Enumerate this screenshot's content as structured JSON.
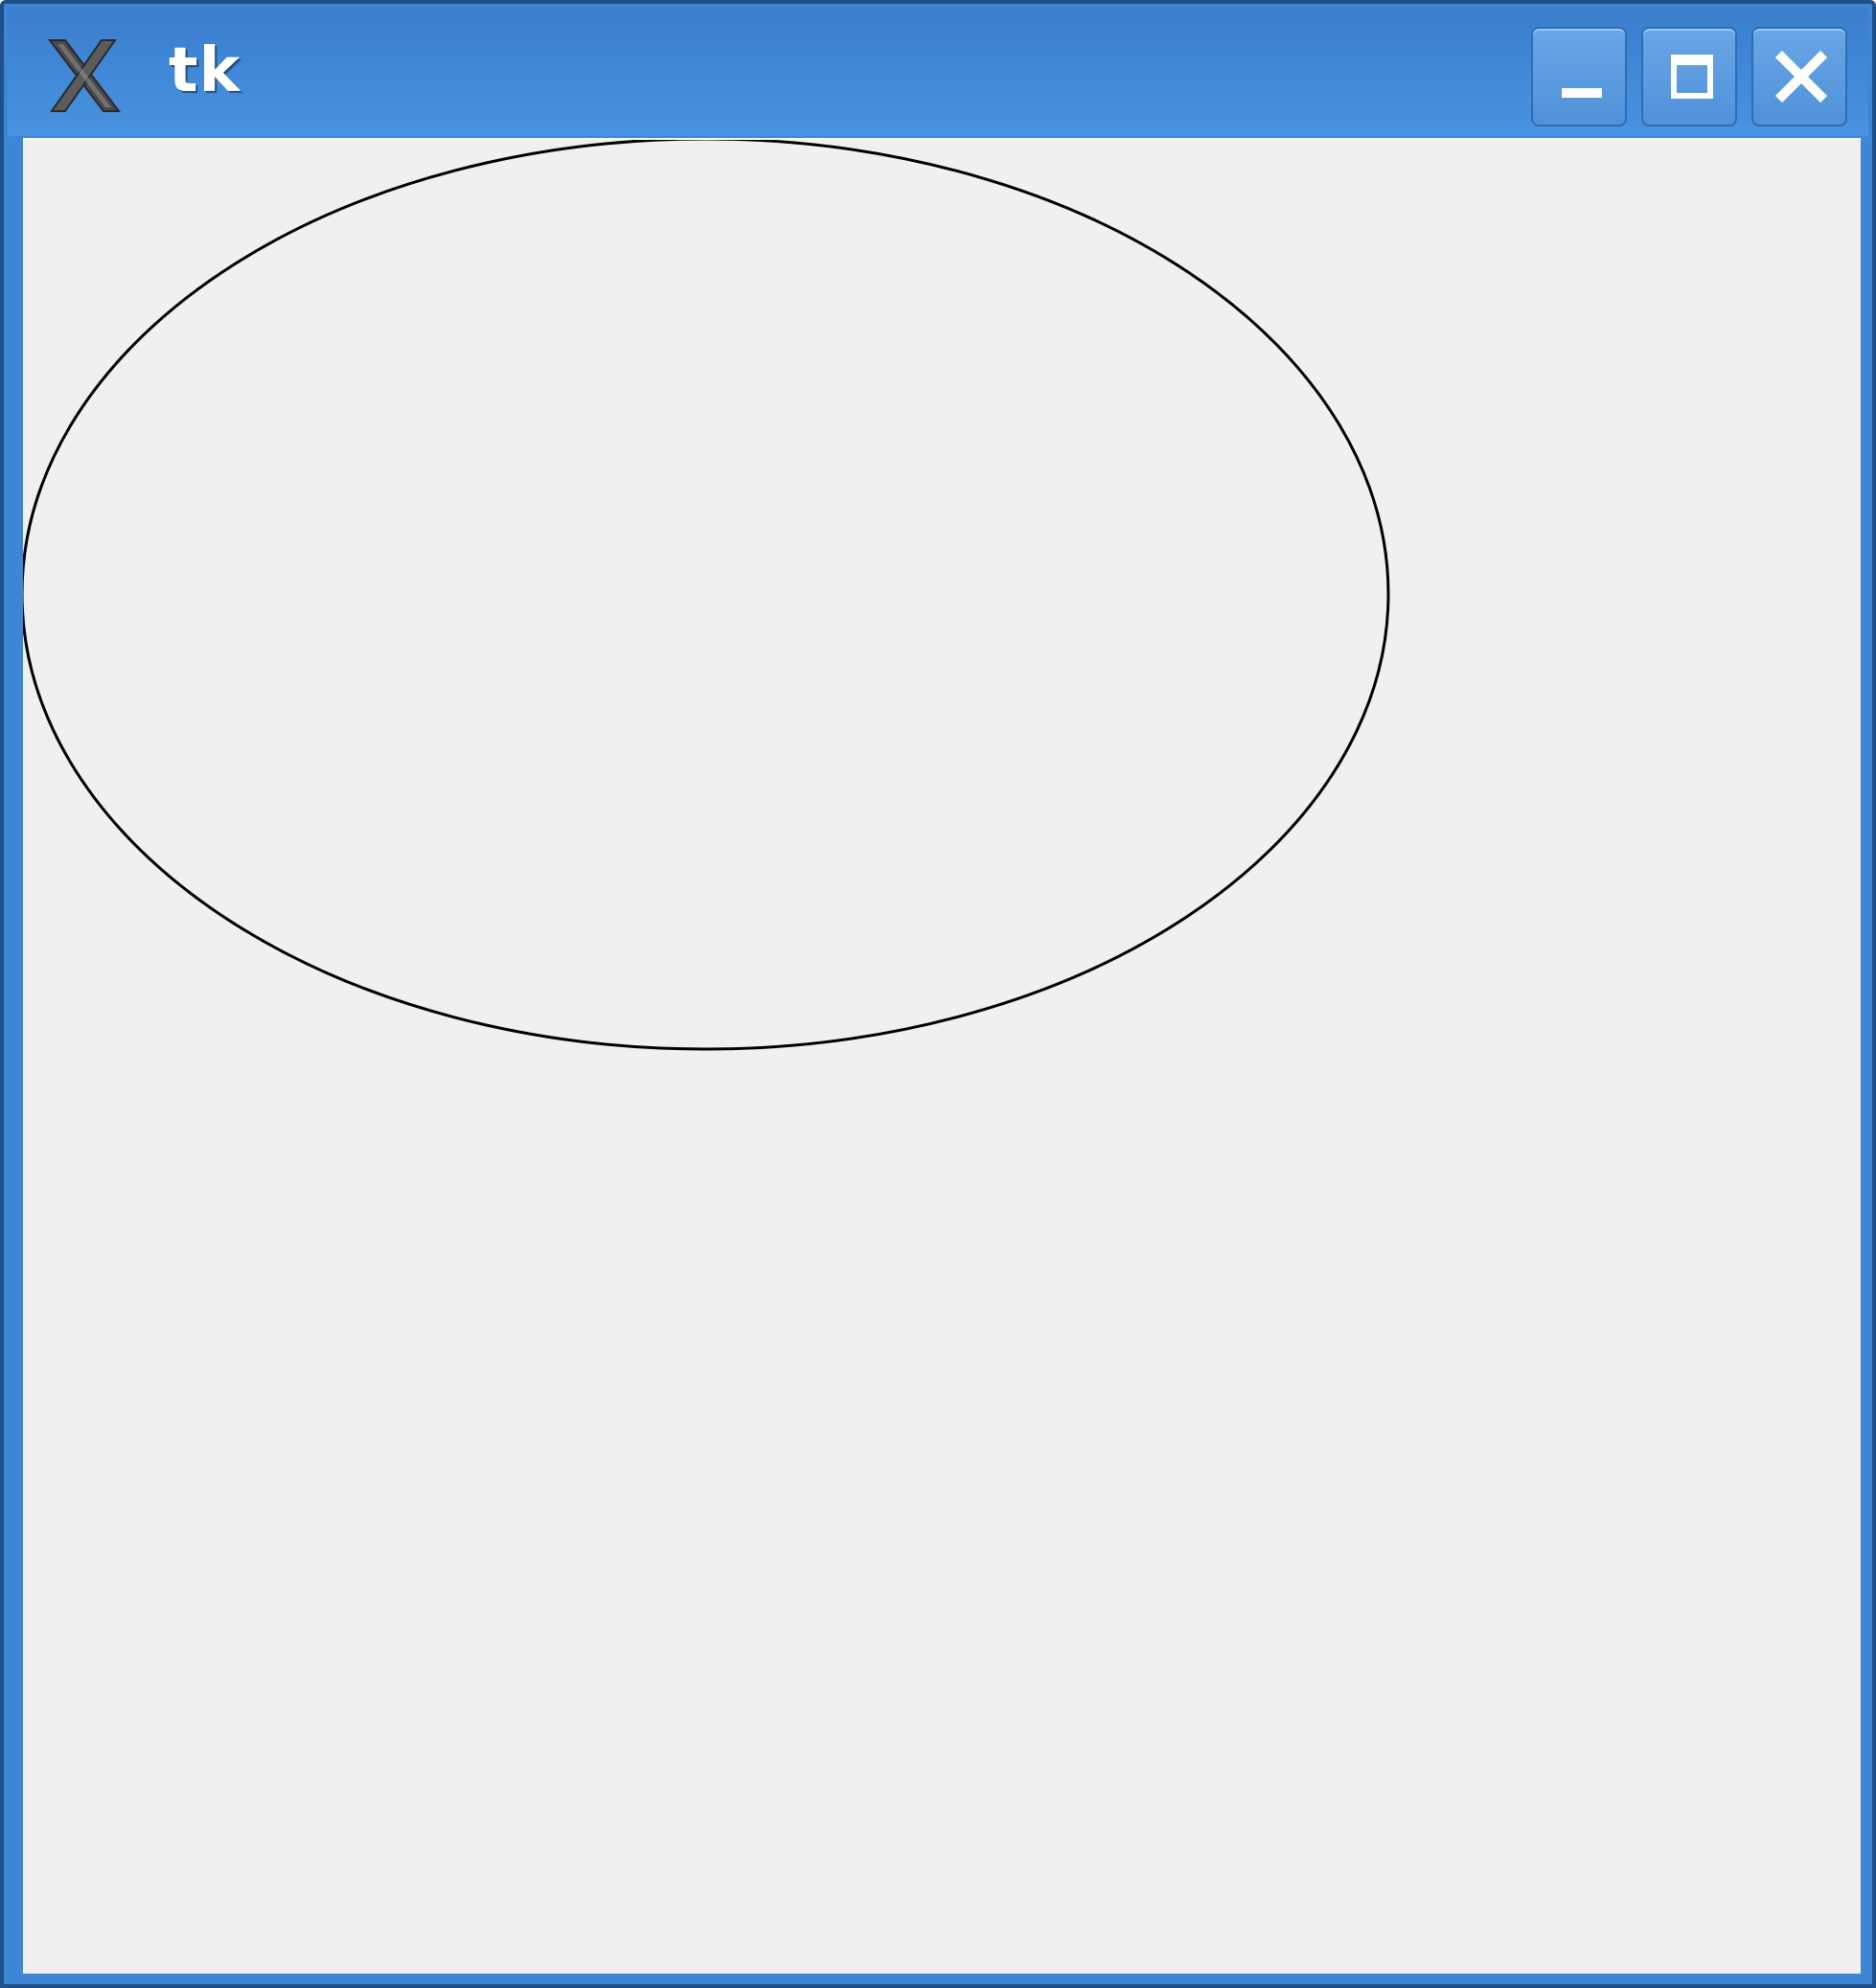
{
  "window": {
    "title": "tk",
    "app_icon": "x-window-icon",
    "controls": {
      "minimize_icon": "minimize-icon",
      "maximize_icon": "maximize-icon",
      "close_icon": "close-icon"
    }
  },
  "canvas": {
    "background": "#f0f0f0",
    "shapes": [
      {
        "type": "oval",
        "outline": "#000000",
        "fill": "none"
      }
    ]
  }
}
